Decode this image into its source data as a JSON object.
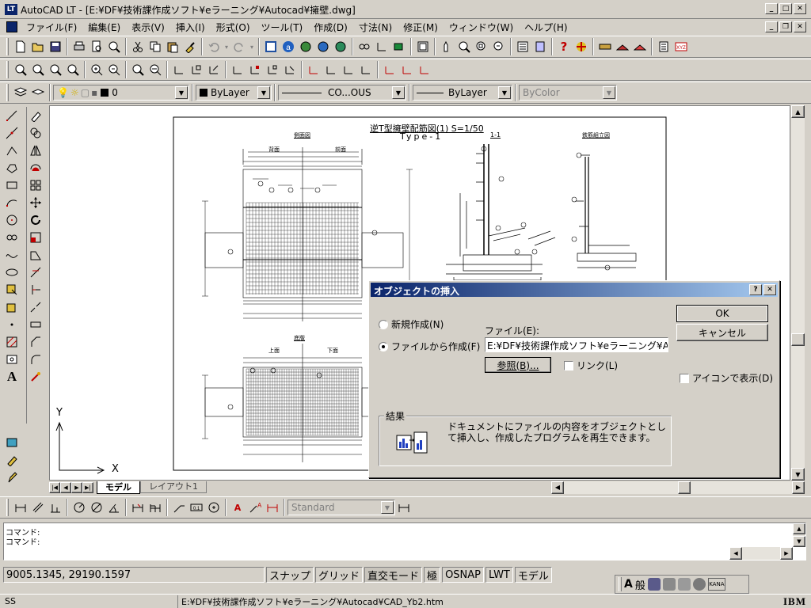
{
  "app": {
    "title": "AutoCAD LT - [E:¥DF¥技術課作成ソフト¥eラーニング¥Autocad¥擁壁.dwg]",
    "logo_text": "LT",
    "menu": [
      "ファイル(F)",
      "編集(E)",
      "表示(V)",
      "挿入(I)",
      "形式(O)",
      "ツール(T)",
      "作成(D)",
      "寸法(N)",
      "修正(M)",
      "ウィンドウ(W)",
      "ヘルプ(H)"
    ]
  },
  "properties_bar": {
    "layer_value": "0",
    "color_value": "ByLayer",
    "linetype_value": "CO...OUS",
    "lineweight_value": "ByLayer",
    "plotstyle_value": "ByColor"
  },
  "drawing": {
    "title": "逆T型擁壁配筋図(1) S=1/50",
    "subtitle": "Type-1",
    "front_view_label": "側面図",
    "left_label": "背面",
    "right_label": "前面",
    "section_label": "1-1",
    "rebar_label": "鉄筋組立図",
    "plan_label": "底版",
    "plan_left": "上面",
    "plan_right": "下面",
    "ucs_x": "X",
    "ucs_y": "Y"
  },
  "tabs": {
    "model": "モデル",
    "layout": "レイアウト1"
  },
  "dimension_bar": {
    "style": "Standard"
  },
  "command": {
    "lines": [
      "コマンド:",
      "コマンド:"
    ]
  },
  "status": {
    "coords": "9005.1345,  29190.1597",
    "snap": "スナップ",
    "grid": "グリッド",
    "ortho": "直交モード",
    "polar": "極",
    "osnap": "OSNAP",
    "lwt": "LWT",
    "model": "モデル"
  },
  "bottom": {
    "left_text": "SS",
    "path": "E:¥DF¥技術課作成ソフト¥eラーニング¥Autocad¥CAD_Yb2.htm",
    "ime_text": "般",
    "brand": "IBM"
  },
  "dialog": {
    "title": "オブジェクトの挿入",
    "help": "?",
    "close": "✕",
    "ok": "OK",
    "cancel": "キャンセル",
    "radio_new": "新規作成(N)",
    "radio_file": "ファイルから作成(F)",
    "file_label": "ファイル(E):",
    "file_value": "E:¥DF¥技術課作成ソフト¥eラーニング¥Autocad¥",
    "browse": "参照(B)...",
    "link_label": "リンク(L)",
    "icon_label": "アイコンで表示(D)",
    "result_label": "結果",
    "result_text": "ドキュメントにファイルの内容をオブジェクトとして挿入し、作成したプログラムを再生できます。"
  }
}
